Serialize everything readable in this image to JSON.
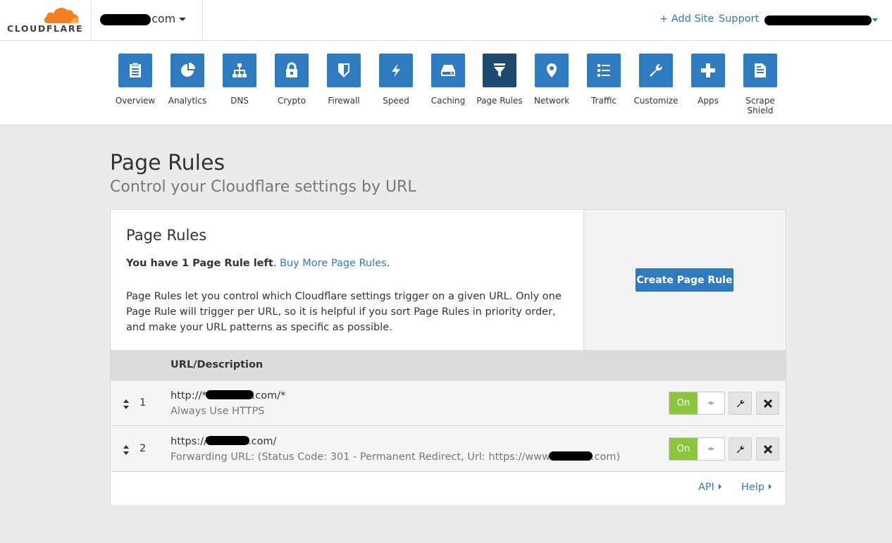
{
  "header": {
    "logo_text": "CLOUDFLARE",
    "domain_suffix": ".com",
    "add_site": "+ Add Site",
    "support": "Support"
  },
  "nav": {
    "items": [
      {
        "label": "Overview",
        "icon": "clipboard-icon"
      },
      {
        "label": "Analytics",
        "icon": "pie-chart-icon"
      },
      {
        "label": "DNS",
        "icon": "sitemap-icon"
      },
      {
        "label": "Crypto",
        "icon": "lock-icon"
      },
      {
        "label": "Firewall",
        "icon": "shield-icon"
      },
      {
        "label": "Speed",
        "icon": "lightning-icon"
      },
      {
        "label": "Caching",
        "icon": "hard-drive-icon"
      },
      {
        "label": "Page Rules",
        "icon": "filter-icon",
        "active": true
      },
      {
        "label": "Network",
        "icon": "map-pin-icon"
      },
      {
        "label": "Traffic",
        "icon": "list-icon"
      },
      {
        "label": "Customize",
        "icon": "wrench-icon"
      },
      {
        "label": "Apps",
        "icon": "plus-icon"
      },
      {
        "label": "Scrape Shield",
        "icon": "document-icon"
      }
    ]
  },
  "page": {
    "title": "Page Rules",
    "subtitle": "Control your Cloudflare settings by URL"
  },
  "card": {
    "title": "Page Rules",
    "quota_bold": "You have 1 Page Rule left",
    "quota_sep": ".",
    "buy_more": "Buy More Page Rules",
    "quota_end": ".",
    "description": "Page Rules let you control which Cloudflare settings trigger on a given URL. Only one Page Rule will trigger per URL, so it is helpful if you sort Page Rules in priority order, and make your URL patterns as specific as possible.",
    "create_button": "Create Page Rule"
  },
  "table": {
    "column_header": "URL/Description",
    "rows": [
      {
        "index": "1",
        "url_prefix": "http://*",
        "url_suffix": ".com/*",
        "description": "Always Use HTTPS",
        "desc_suffix": "",
        "status": "On"
      },
      {
        "index": "2",
        "url_prefix": "https://",
        "url_suffix": ".com/",
        "description": "Forwarding URL: (Status Code: 301 - Permanent Redirect, Url: https://www",
        "desc_suffix": ".com)",
        "status": "On"
      }
    ]
  },
  "footer": {
    "api": "API",
    "help": "Help"
  },
  "colors": {
    "brand_blue": "#2f7bbf",
    "active_tab": "#1e4a72",
    "toggle_on": "#8cc63e",
    "logo_orange": "#f38020"
  }
}
